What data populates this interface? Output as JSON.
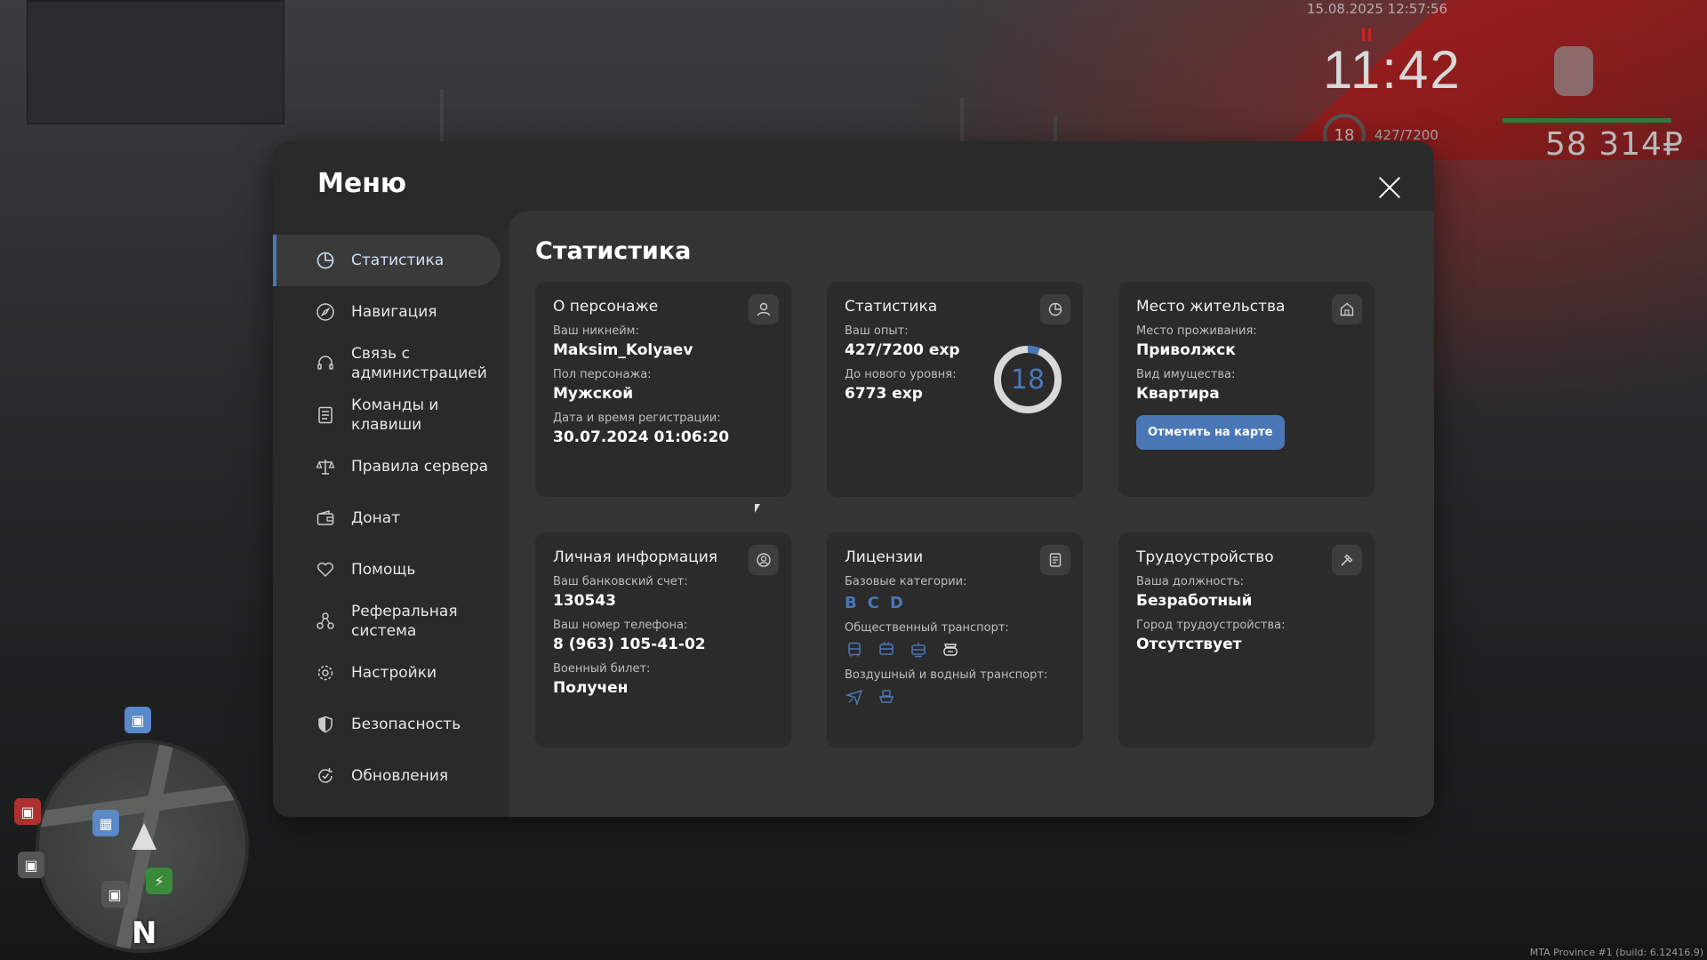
{
  "hud": {
    "datetime": "15.08.2025 12:57:56",
    "time": "11:42",
    "level": "18",
    "exp": "427/7200",
    "money": "58 314₽",
    "build": "MTA Province #1 (build: 6.12416.9)"
  },
  "minimap": {
    "north": "N"
  },
  "menu": {
    "title": "Меню",
    "sidebar": [
      {
        "label": "Статистика",
        "icon": "pie-chart-icon"
      },
      {
        "label": "Навигация",
        "icon": "compass-icon"
      },
      {
        "label": "Связь с администрацией",
        "icon": "headset-icon"
      },
      {
        "label": "Команды и клавиши",
        "icon": "document-list-icon"
      },
      {
        "label": "Правила сервера",
        "icon": "scales-icon"
      },
      {
        "label": "Донат",
        "icon": "wallet-icon"
      },
      {
        "label": "Помощь",
        "icon": "heart-hands-icon"
      },
      {
        "label": "Реферальная система",
        "icon": "referral-icon"
      },
      {
        "label": "Настройки",
        "icon": "gear-icon"
      },
      {
        "label": "Безопасность",
        "icon": "shield-icon"
      },
      {
        "label": "Обновления",
        "icon": "refresh-icon"
      }
    ]
  },
  "content": {
    "title": "Статистика",
    "about": {
      "title": "О персонаже",
      "nick_label": "Ваш никнейм:",
      "nick": "Maksim_Kolyaev",
      "gender_label": "Пол персонажа:",
      "gender": "Мужской",
      "reg_label": "Дата и время регистрации:",
      "reg": "30.07.2024 01:06:20"
    },
    "stats": {
      "title": "Статистика",
      "exp_label": "Ваш опыт:",
      "exp": "427/7200 exp",
      "next_label": "До нового уровня:",
      "next": "6773 exp",
      "level": "18",
      "progress": 0.0593
    },
    "residence": {
      "title": "Место жительства",
      "place_label": "Место проживания:",
      "place": "Приволжск",
      "type_label": "Вид имущества:",
      "type": "Квартира",
      "button": "Отметить на карте"
    },
    "personal": {
      "title": "Личная информация",
      "bank_label": "Ваш банковский счет:",
      "bank": "130543",
      "phone_label": "Ваш номер телефона:",
      "phone": "8 (963) 105-41-02",
      "military_label": "Военный билет:",
      "military": "Получен"
    },
    "licenses": {
      "title": "Лицензии",
      "base_label": "Базовые категории:",
      "base": [
        "B",
        "C",
        "D"
      ],
      "public_label": "Общественный транспорт:",
      "public_icons": [
        "bus-icon",
        "trolleybus-icon",
        "tram-icon",
        "taxi-icon"
      ],
      "airwater_label": "Воздушный и водный транспорт:",
      "airwater_icons": [
        "plane-icon",
        "boat-icon"
      ]
    },
    "job": {
      "title": "Трудоустройство",
      "position_label": "Ваша должность:",
      "position": "Безработный",
      "city_label": "Город трудоустройства:",
      "city": "Отсутствует"
    }
  },
  "colors": {
    "accent": "#4a77b6",
    "panel": "#2a2a2a",
    "content": "#343434",
    "card": "#2b2b2b"
  }
}
